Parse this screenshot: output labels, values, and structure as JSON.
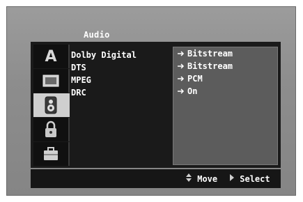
{
  "menu": {
    "title": "Audio",
    "sidebar": [
      {
        "icon": "letter-a-icon",
        "letter": "A"
      },
      {
        "icon": "screen-icon"
      },
      {
        "icon": "speaker-icon",
        "active": true
      },
      {
        "icon": "lock-icon"
      },
      {
        "icon": "briefcase-icon"
      }
    ],
    "items": [
      {
        "label": "Dolby Digital",
        "value": "Bitstream"
      },
      {
        "label": "DTS",
        "value": "Bitstream"
      },
      {
        "label": "MPEG",
        "value": "PCM"
      },
      {
        "label": "DRC",
        "value": "On"
      }
    ],
    "footer": {
      "move_label": "Move",
      "select_label": "Select"
    }
  }
}
